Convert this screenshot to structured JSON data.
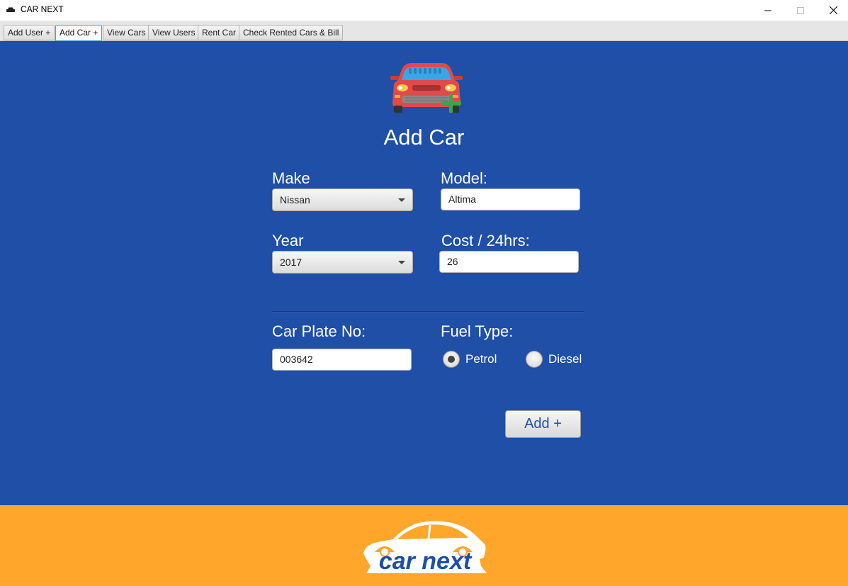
{
  "window": {
    "title": "CAR NEXT",
    "icons": [
      "car-icon",
      "minimize-icon",
      "maximize-icon",
      "close-icon"
    ]
  },
  "tabs": [
    {
      "label": "Add User +"
    },
    {
      "label": "Add Car +",
      "active": true
    },
    {
      "label": "View Cars"
    },
    {
      "label": "View Users"
    },
    {
      "label": "Rent Car"
    },
    {
      "label": "Check Rented Cars & Bill"
    }
  ],
  "form": {
    "title": "Add Car",
    "make": {
      "label": "Make",
      "value": "Nissan"
    },
    "model": {
      "label": "Model:",
      "value": "Altima"
    },
    "year": {
      "label": "Year",
      "value": "2017"
    },
    "cost": {
      "label": "Cost / 24hrs:",
      "value": "26"
    },
    "plate": {
      "label": "Car Plate No:",
      "value": "003642"
    },
    "fuel": {
      "label": "Fuel Type:",
      "options": [
        {
          "label": "Petrol",
          "selected": true
        },
        {
          "label": "Diesel",
          "selected": false
        }
      ]
    },
    "add_button": "Add +"
  },
  "footer": {
    "logo_text": "car next"
  },
  "colors": {
    "main_bg": "#1f4fa6",
    "footer_bg": "#ffa62b",
    "accent_car": "#e04a4a",
    "plus_green": "#3fa34d"
  }
}
